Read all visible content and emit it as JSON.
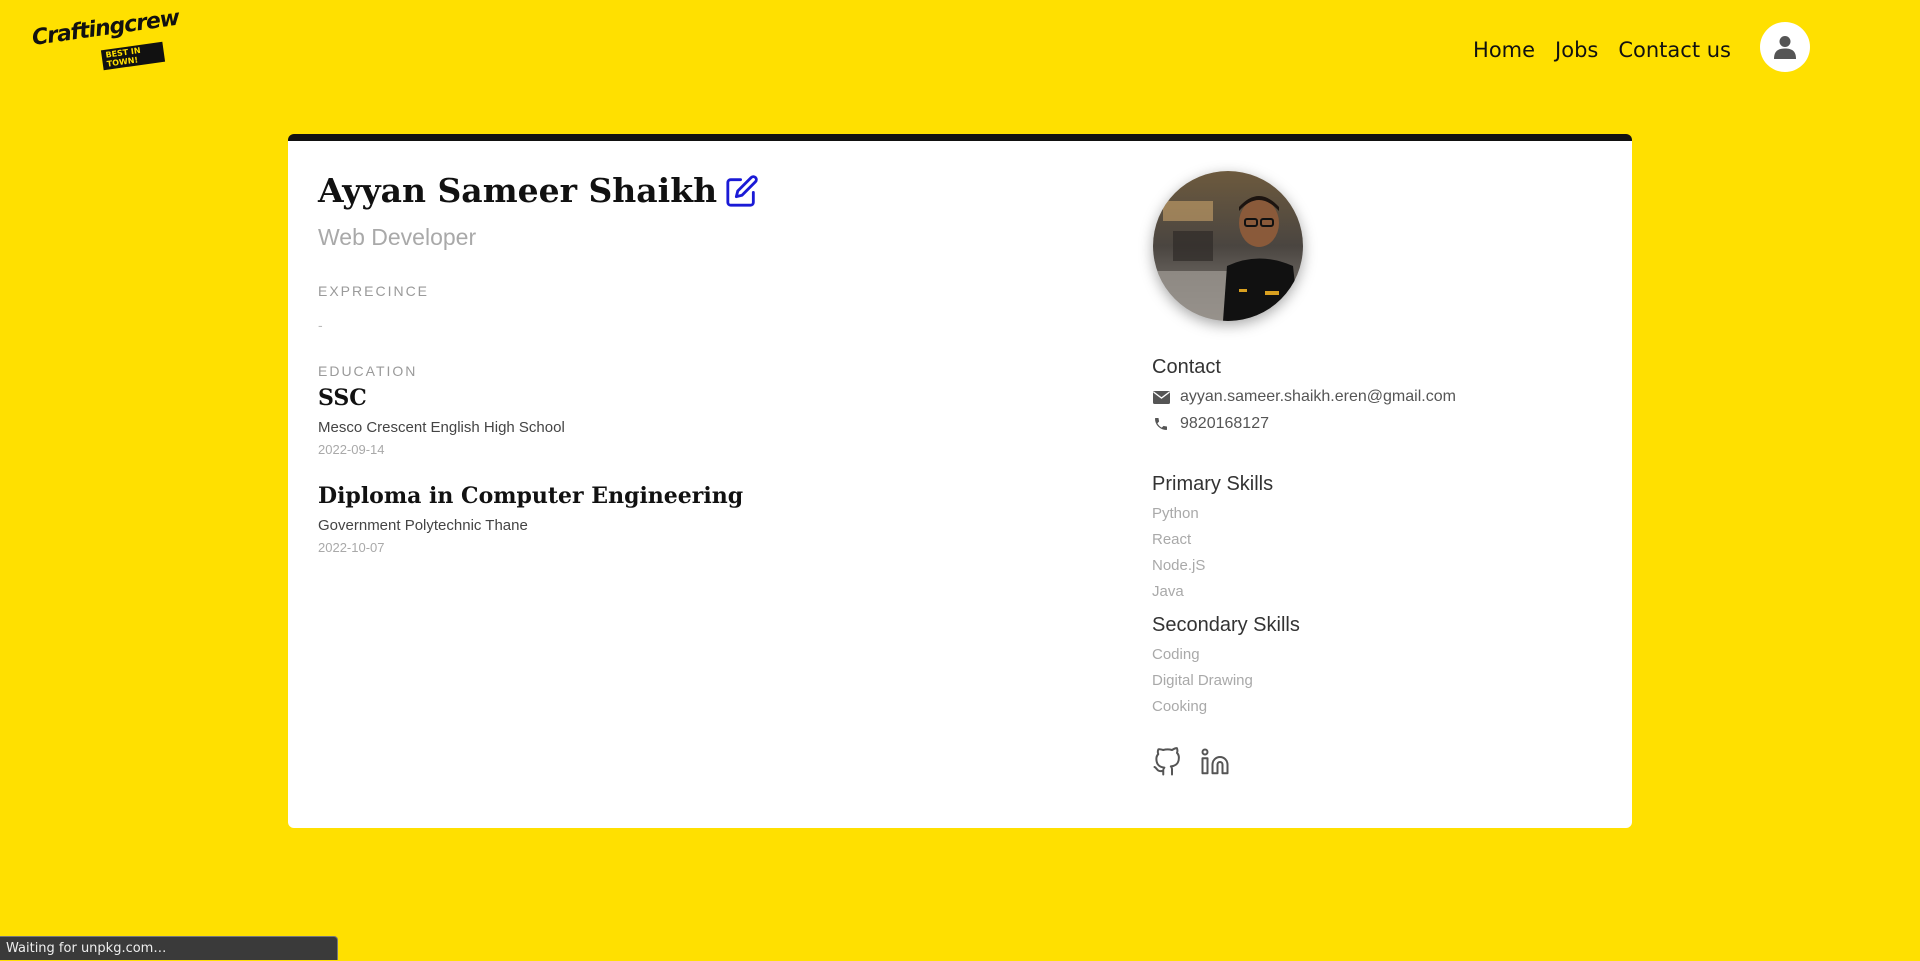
{
  "brand": {
    "name": "Craftingcrew",
    "tagline": "BEST IN TOWN!"
  },
  "nav": {
    "items": [
      "Home",
      "Jobs",
      "Contact us"
    ]
  },
  "icons": {
    "user": "user-icon",
    "edit": "edit-icon",
    "mail": "envelope-icon",
    "phone": "phone-icon",
    "github": "github-icon",
    "linkedin": "linkedin-icon"
  },
  "colors": {
    "background": "#ffe000",
    "edit_icon": "#1a1ad6",
    "card": "#ffffff"
  },
  "profile": {
    "name": "Ayyan Sameer Shaikh",
    "role": "Web Developer",
    "experience_label": "EXPRECINCE",
    "experience_value": "-",
    "education_label": "EDUCATION",
    "education": [
      {
        "degree": "SSC",
        "school": "Mesco Crescent English High School",
        "date": "2022-09-14"
      },
      {
        "degree": "Diploma in Computer Engineering",
        "school": "Government Polytechnic Thane",
        "date": "2022-10-07"
      }
    ]
  },
  "contact": {
    "title": "Contact",
    "email": "ayyan.sameer.shaikh.eren@gmail.com",
    "phone": "9820168127"
  },
  "skills": {
    "primary_title": "Primary Skills",
    "primary": [
      "Python",
      "React",
      "Node.jS",
      "Java"
    ],
    "secondary_title": "Secondary Skills",
    "secondary": [
      "Coding",
      "Digital Drawing",
      "Cooking"
    ]
  },
  "status_bar": "Waiting for unpkg.com…"
}
